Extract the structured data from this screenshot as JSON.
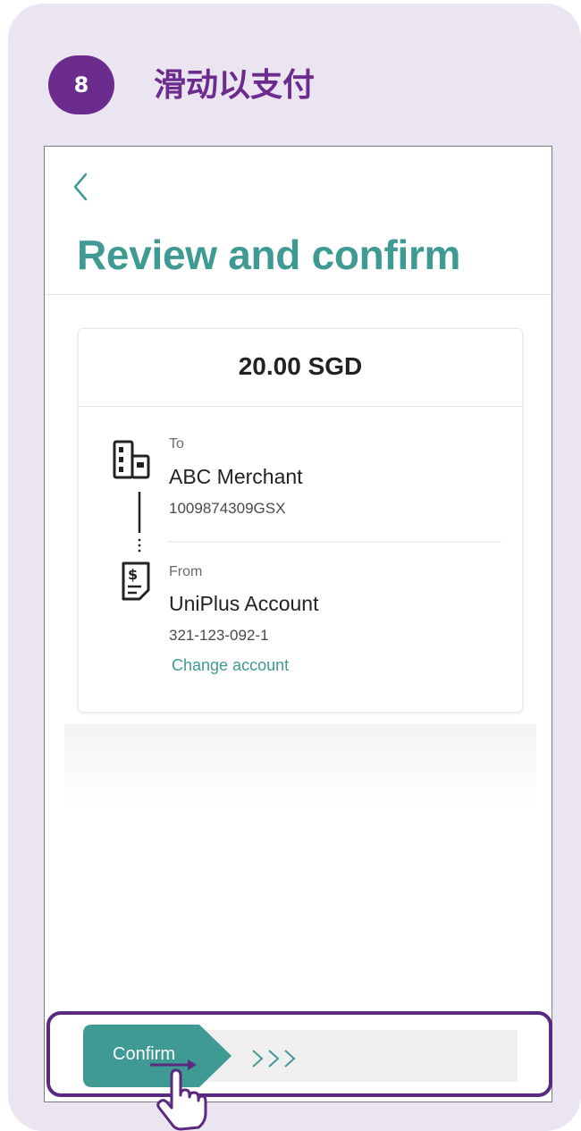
{
  "step": {
    "number": "8",
    "title": "滑动以支付"
  },
  "header": {
    "back_icon": "chevron-left-icon",
    "title": "Review and confirm"
  },
  "review": {
    "amount": "20.00 SGD",
    "to": {
      "label": "To",
      "name": "ABC Merchant",
      "account": "1009874309GSX",
      "icon": "merchant-building-icon"
    },
    "from": {
      "label": "From",
      "name": "UniPlus Account",
      "account": "321-123-092-1",
      "change_link": "Change account",
      "icon": "receipt-dollar-icon"
    }
  },
  "slider": {
    "label": "Confirm",
    "hint_icon": "triple-chevron-right-icon"
  },
  "colors": {
    "background": "#ebe4f1",
    "brand_purple": "#6b2c8e",
    "accent_teal": "#3e9a92",
    "slider_outline": "#5b2a80"
  }
}
